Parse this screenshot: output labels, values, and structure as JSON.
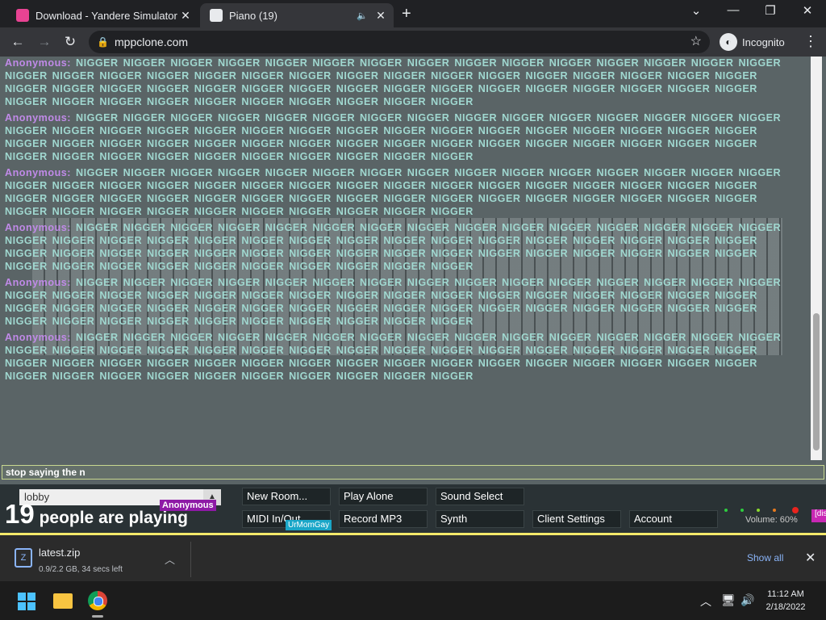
{
  "browser": {
    "tabs": [
      {
        "title": "Download - Yandere Simulator",
        "active": false
      },
      {
        "title": "Piano (19)",
        "active": true
      }
    ],
    "new_tab": "+",
    "address": "mppclone.com",
    "incognito_label": "Incognito",
    "window_controls": [
      "chevron-down-icon",
      "minimize-icon",
      "restore-icon",
      "close-icon"
    ]
  },
  "chat": {
    "messages": [
      {
        "author": "Anonymous:",
        "text": "NIGGER NIGGER NIGGER NIGGER NIGGER NIGGER NIGGER NIGGER NIGGER NIGGER NIGGER NIGGER NIGGER NIGGER NIGGER NIGGER NIGGER NIGGER NIGGER NIGGER NIGGER NIGGER NIGGER NIGGER NIGGER NIGGER NIGGER NIGGER NIGGER NIGGER NIGGER NIGGER NIGGER NIGGER NIGGER NIGGER NIGGER NIGGER NIGGER NIGGER NIGGER NIGGER NIGGER NIGGER NIGGER NIGGER NIGGER NIGGER NIGGER NIGGER NIGGER NIGGER NIGGER NIGGER NIGGER NIGGER NIGGER"
      },
      {
        "author": "Anonymous:",
        "text": "NIGGER NIGGER NIGGER NIGGER NIGGER NIGGER NIGGER NIGGER NIGGER NIGGER NIGGER NIGGER NIGGER NIGGER NIGGER NIGGER NIGGER NIGGER NIGGER NIGGER NIGGER NIGGER NIGGER NIGGER NIGGER NIGGER NIGGER NIGGER NIGGER NIGGER NIGGER NIGGER NIGGER NIGGER NIGGER NIGGER NIGGER NIGGER NIGGER NIGGER NIGGER NIGGER NIGGER NIGGER NIGGER NIGGER NIGGER NIGGER NIGGER NIGGER NIGGER NIGGER NIGGER NIGGER NIGGER NIGGER NIGGER"
      },
      {
        "author": "Anonymous:",
        "text": "NIGGER NIGGER NIGGER NIGGER NIGGER NIGGER NIGGER NIGGER NIGGER NIGGER NIGGER NIGGER NIGGER NIGGER NIGGER NIGGER NIGGER NIGGER NIGGER NIGGER NIGGER NIGGER NIGGER NIGGER NIGGER NIGGER NIGGER NIGGER NIGGER NIGGER NIGGER NIGGER NIGGER NIGGER NIGGER NIGGER NIGGER NIGGER NIGGER NIGGER NIGGER NIGGER NIGGER NIGGER NIGGER NIGGER NIGGER NIGGER NIGGER NIGGER NIGGER NIGGER NIGGER NIGGER NIGGER NIGGER NIGGER"
      },
      {
        "author": "Anonymous:",
        "text": "NIGGER NIGGER NIGGER NIGGER NIGGER NIGGER NIGGER NIGGER NIGGER NIGGER NIGGER NIGGER NIGGER NIGGER NIGGER NIGGER NIGGER NIGGER NIGGER NIGGER NIGGER NIGGER NIGGER NIGGER NIGGER NIGGER NIGGER NIGGER NIGGER NIGGER NIGGER NIGGER NIGGER NIGGER NIGGER NIGGER NIGGER NIGGER NIGGER NIGGER NIGGER NIGGER NIGGER NIGGER NIGGER NIGGER NIGGER NIGGER NIGGER NIGGER NIGGER NIGGER NIGGER NIGGER NIGGER NIGGER NIGGER"
      },
      {
        "author": "Anonymous:",
        "text": "NIGGER NIGGER NIGGER NIGGER NIGGER NIGGER NIGGER NIGGER NIGGER NIGGER NIGGER NIGGER NIGGER NIGGER NIGGER NIGGER NIGGER NIGGER NIGGER NIGGER NIGGER NIGGER NIGGER NIGGER NIGGER NIGGER NIGGER NIGGER NIGGER NIGGER NIGGER NIGGER NIGGER NIGGER NIGGER NIGGER NIGGER NIGGER NIGGER NIGGER NIGGER NIGGER NIGGER NIGGER NIGGER NIGGER NIGGER NIGGER NIGGER NIGGER NIGGER NIGGER NIGGER NIGGER NIGGER NIGGER NIGGER"
      },
      {
        "author": "Anonymous:",
        "text": "NIGGER NIGGER NIGGER NIGGER NIGGER NIGGER NIGGER NIGGER NIGGER NIGGER NIGGER NIGGER NIGGER NIGGER NIGGER NIGGER NIGGER NIGGER NIGGER NIGGER NIGGER NIGGER NIGGER NIGGER NIGGER NIGGER NIGGER NIGGER NIGGER NIGGER NIGGER NIGGER NIGGER NIGGER NIGGER NIGGER NIGGER NIGGER NIGGER NIGGER NIGGER NIGGER NIGGER NIGGER NIGGER NIGGER NIGGER NIGGER NIGGER NIGGER NIGGER NIGGER NIGGER NIGGER NIGGER NIGGER NIGGER"
      }
    ],
    "input_value": "stop saying the n"
  },
  "piano": {
    "room": "lobby",
    "people_count": "19",
    "people_label": "people are playing",
    "user_tags": [
      "Anonymous",
      "UrMomGay"
    ],
    "buttons": {
      "new_room": "New Room...",
      "play_alone": "Play Alone",
      "sound_select": "Sound Select",
      "midi": "MIDI In/Out",
      "record": "Record MP3",
      "synth": "Synth",
      "client_settings": "Client Settings",
      "account": "Account"
    },
    "volume": "Volume: 60%",
    "discord_label": "[dis"
  },
  "download": {
    "filename": "latest.zip",
    "status": "0.9/2.2 GB, 34 secs left",
    "show_all": "Show all"
  },
  "taskbar": {
    "time": "11:12 AM",
    "date": "2/18/2022"
  }
}
